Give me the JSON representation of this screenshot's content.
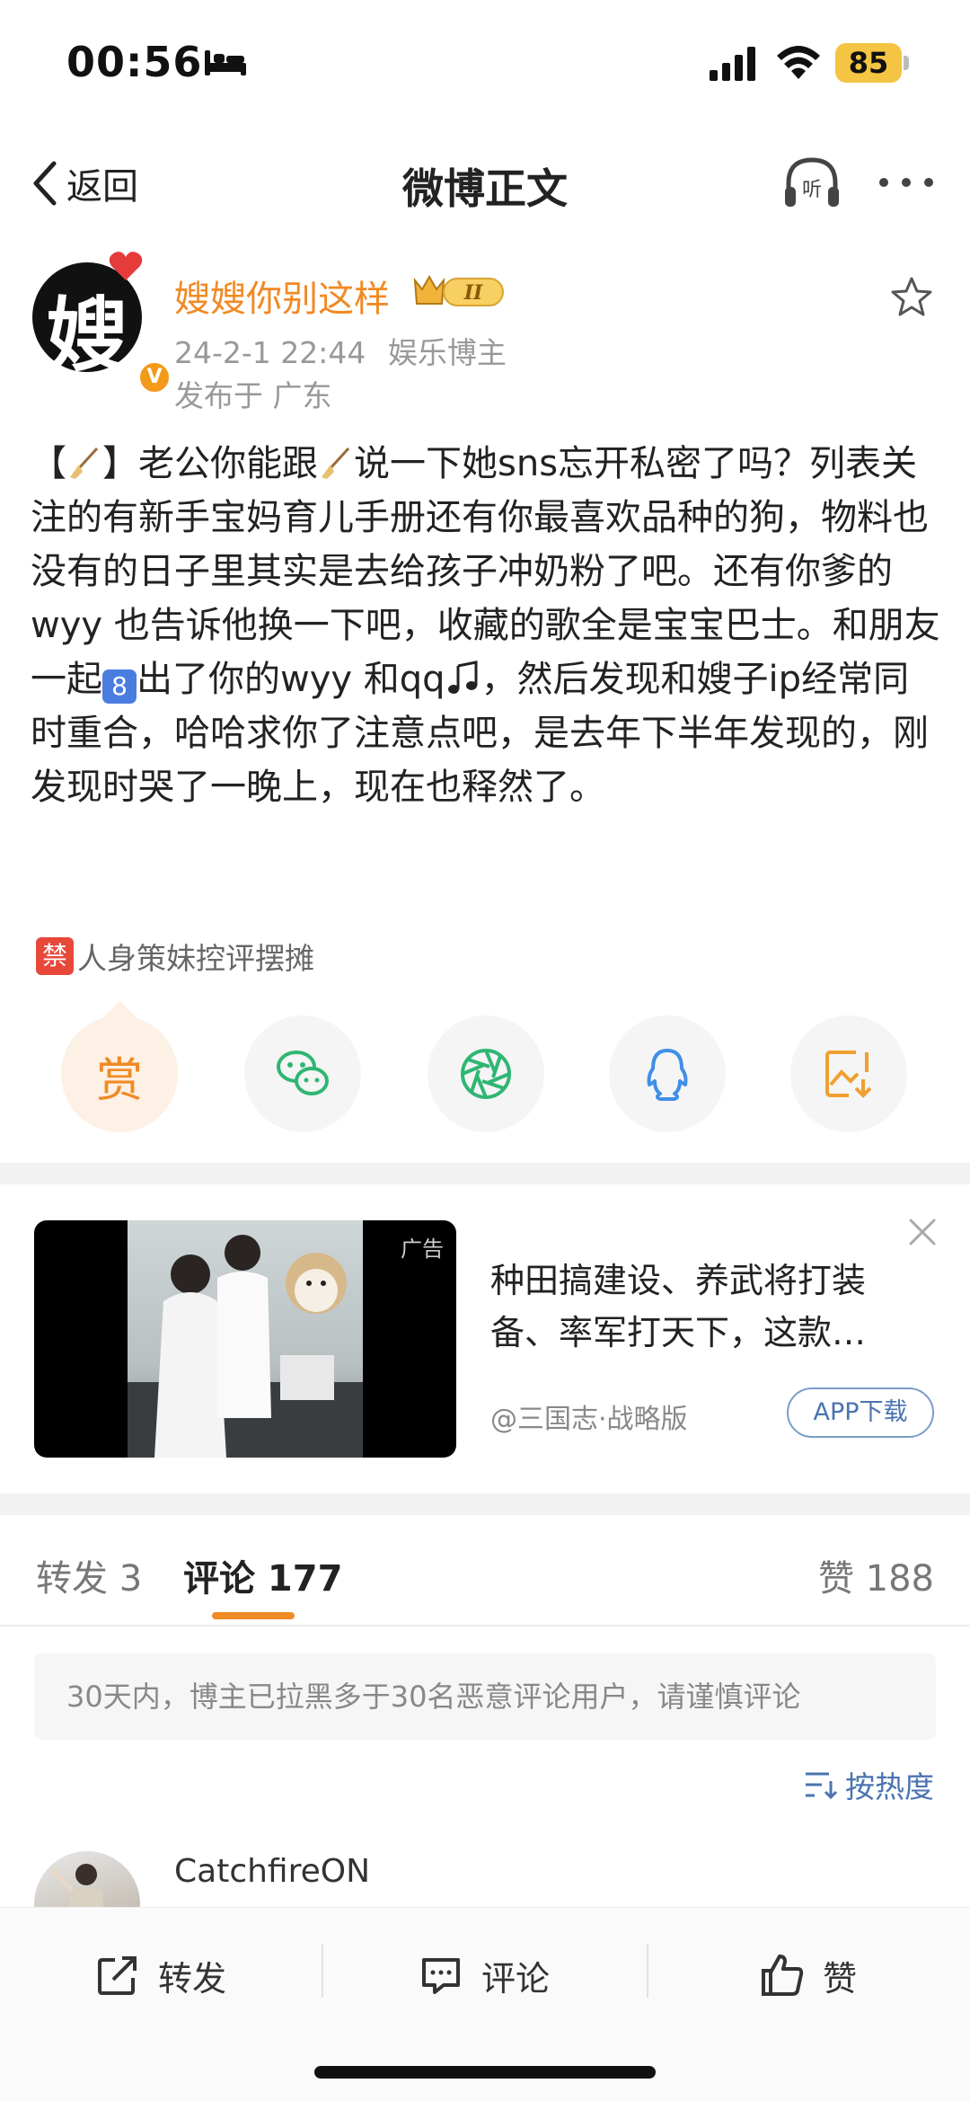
{
  "status_bar": {
    "time": "00:56",
    "battery": "85"
  },
  "nav": {
    "back_label": "返回",
    "title": "微博正文"
  },
  "post": {
    "avatar_char": "嫂",
    "username": "嫂嫂你别这样",
    "vip_level": "II",
    "date": "24-2-1 22:44",
    "category": "娱乐博主",
    "location": "发布于 广东",
    "content": {
      "bracket_open": "【",
      "bracket_close": "】",
      "line1_a": "老公你能跟",
      "line1_b": "说一下她sns忘开私密了吗？列表关注的有新手宝妈育儿手册还有你最喜欢品种的狗，物料也没有的日子里其实是去给孩子冲奶粉了吧。还有你爹的wyy 也告诉他换一下吧，收藏的歌全是宝宝巴士。和朋友一起",
      "keycap": "8",
      "line2": "出了你的wyy 和qq",
      "line3": "，然后发现和嫂子ip经常同时重合，哈哈求你了注意点吧，是去年下半年发现的，刚发现时哭了一晚上，现在也释然了。"
    },
    "tag_icon": "禁",
    "tag_label": "人身策妹控评摆摊"
  },
  "share": {
    "reward_label": "赏"
  },
  "ad": {
    "badge": "广告",
    "text": "种田搞建设、养武将打装备、率军打天下，这款…",
    "source": "@三国志·战略版",
    "download_label": "APP下载"
  },
  "tabs": {
    "repost": "转发 3",
    "comment": "评论 177",
    "likes": "赞 188"
  },
  "notice": "30天内，博主已拉黑多于30名恶意评论用户，请谨慎评论",
  "sort_label": "按热度",
  "comment": {
    "username": "CatchfireON"
  },
  "bottom_bar": {
    "repost": "转发",
    "comment": "评论",
    "like": "赞"
  },
  "colors": {
    "accent": "#f08a24",
    "link": "#4a73b0"
  }
}
